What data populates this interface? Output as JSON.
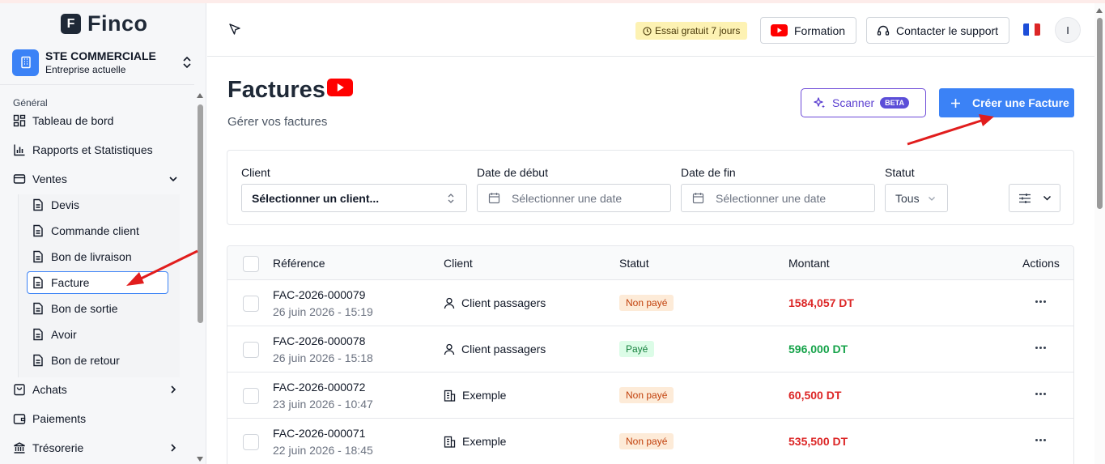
{
  "app": {
    "name": "Finco"
  },
  "company": {
    "name": "STE COMMERCIALE",
    "subtitle": "Entreprise actuelle"
  },
  "sidebar": {
    "section_label": "Général",
    "items": [
      {
        "label": "Tableau de bord",
        "icon": "dashboard-icon"
      },
      {
        "label": "Rapports et Statistiques",
        "icon": "bar-chart-icon"
      },
      {
        "label": "Ventes",
        "icon": "card-icon",
        "expanded": true
      },
      {
        "label": "Achats",
        "icon": "bag-icon"
      },
      {
        "label": "Paiements",
        "icon": "wallet-icon"
      },
      {
        "label": "Trésorerie",
        "icon": "bank-icon"
      }
    ],
    "sub_items": [
      {
        "label": "Devis"
      },
      {
        "label": "Commande client"
      },
      {
        "label": "Bon de livraison"
      },
      {
        "label": "Facture",
        "active": true
      },
      {
        "label": "Bon de sortie"
      },
      {
        "label": "Avoir"
      },
      {
        "label": "Bon de retour"
      }
    ]
  },
  "header": {
    "trial_label": "Essai gratuit 7 jours",
    "formation_label": "Formation",
    "support_label": "Contacter le support",
    "avatar_initial": "I"
  },
  "page": {
    "title": "Factures",
    "subtitle": "Gérer vos factures",
    "scan_label": "Scanner",
    "beta_label": "BETA",
    "create_label": "Créer une Facture"
  },
  "filters": {
    "client_label": "Client",
    "client_placeholder": "Sélectionner un client...",
    "start_label": "Date de début",
    "start_placeholder": "Sélectionner une date",
    "end_label": "Date de fin",
    "end_placeholder": "Sélectionner une date",
    "status_label": "Statut",
    "status_value": "Tous"
  },
  "table": {
    "columns": {
      "reference": "Référence",
      "client": "Client",
      "status": "Statut",
      "amount": "Montant",
      "actions": "Actions"
    },
    "rows": [
      {
        "ref": "FAC-2026-000079",
        "date": "26 juin 2026 - 15:19",
        "client": "Client passagers",
        "client_icon": "user-icon",
        "status": "Non payé",
        "amount": "1584,057 DT"
      },
      {
        "ref": "FAC-2026-000078",
        "date": "26 juin 2026 - 15:18",
        "client": "Client passagers",
        "client_icon": "user-icon",
        "status": "Payé",
        "amount": "596,000 DT"
      },
      {
        "ref": "FAC-2026-000072",
        "date": "23 juin 2026 - 10:47",
        "client": "Exemple",
        "client_icon": "building-icon",
        "status": "Non payé",
        "amount": "60,500 DT"
      },
      {
        "ref": "FAC-2026-000071",
        "date": "22 juin 2026 - 18:45",
        "client": "Exemple",
        "client_icon": "building-icon",
        "status": "Non payé",
        "amount": "535,500 DT"
      }
    ]
  },
  "colors": {
    "accent": "#3b82f6",
    "unpaid_text": "#c2410c",
    "unpaid_bg": "#fdebd8",
    "paid_text": "#15803d",
    "paid_bg": "#dcfce7",
    "amount_unpaid": "#dc2626",
    "amount_paid": "#16a34a",
    "annotation_arrow": "#e11d1d"
  }
}
